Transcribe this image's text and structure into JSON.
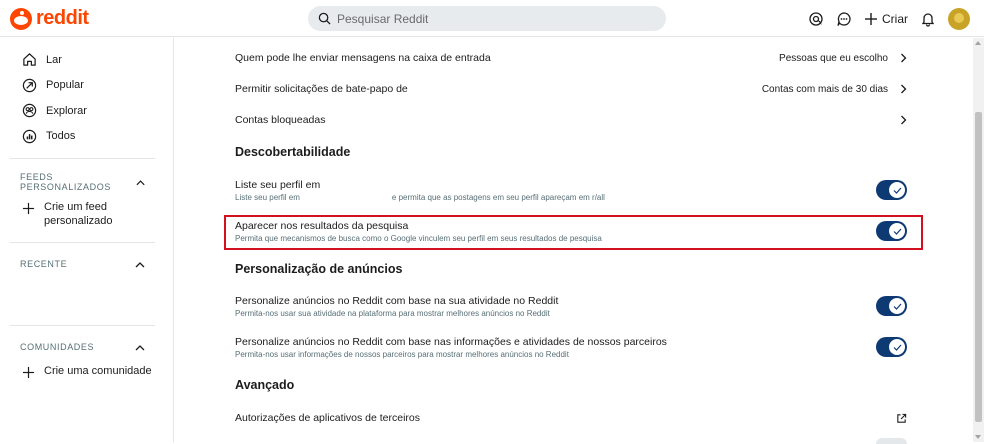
{
  "header": {
    "logo_text": "reddit",
    "search_placeholder": "Pesquisar Reddit",
    "create_label": "Criar",
    "brand_color": "#ff4500"
  },
  "sidebar": {
    "nav": [
      {
        "label": "Lar",
        "icon": "home-icon"
      },
      {
        "label": "Popular",
        "icon": "popular-icon"
      },
      {
        "label": "Explorar",
        "icon": "explore-icon"
      },
      {
        "label": "Todos",
        "icon": "all-icon"
      }
    ],
    "custom_feeds": {
      "title": "FEEDS PERSONALIZADOS",
      "create_label_1": "Crie um feed",
      "create_label_2": "personalizado"
    },
    "recent": {
      "title": "RECENTE"
    },
    "communities": {
      "title": "COMUNIDADES",
      "create_label": "Crie uma comunidade"
    }
  },
  "settings": {
    "messages": {
      "title": "Quem pode lhe enviar mensagens na caixa de entrada",
      "value": "Pessoas que eu escolho"
    },
    "chat": {
      "title": "Permitir solicitações de bate-papo de",
      "value": "Contas com mais de 30 dias"
    },
    "blocked": {
      "title": "Contas bloqueadas"
    },
    "discoverability_heading": "Descobertabilidade",
    "list_profile": {
      "title": "Liste seu perfil em",
      "sub_a": "Liste seu perfil em",
      "sub_b": "e permita que as postagens em seu perfil apareçam em r/all",
      "enabled": true
    },
    "search_results": {
      "title": "Aparecer nos resultados da pesquisa",
      "sub": "Permita que mecanismos de busca como o Google vinculem seu perfil em seus resultados de pesquisa",
      "enabled": true
    },
    "ads_heading": "Personalização de anúncios",
    "ads_activity": {
      "title": "Personalize anúncios no Reddit com base na sua atividade no Reddit",
      "sub": "Permita-nos usar sua atividade na plataforma para mostrar melhores anúncios no Reddit",
      "enabled": true
    },
    "ads_partners": {
      "title": "Personalize anúncios no Reddit com base nas informações e atividades de nossos parceiros",
      "sub": "Permita-nos usar informações de nossos parceiros para mostrar melhores anúncios no Reddit",
      "enabled": true
    },
    "advanced_heading": "Avançado",
    "third_party": {
      "title": "Autorizações de aplicativos de terceiros"
    }
  },
  "colors": {
    "toggle_on": "#0e3a74",
    "highlight": "#d40f1f"
  }
}
